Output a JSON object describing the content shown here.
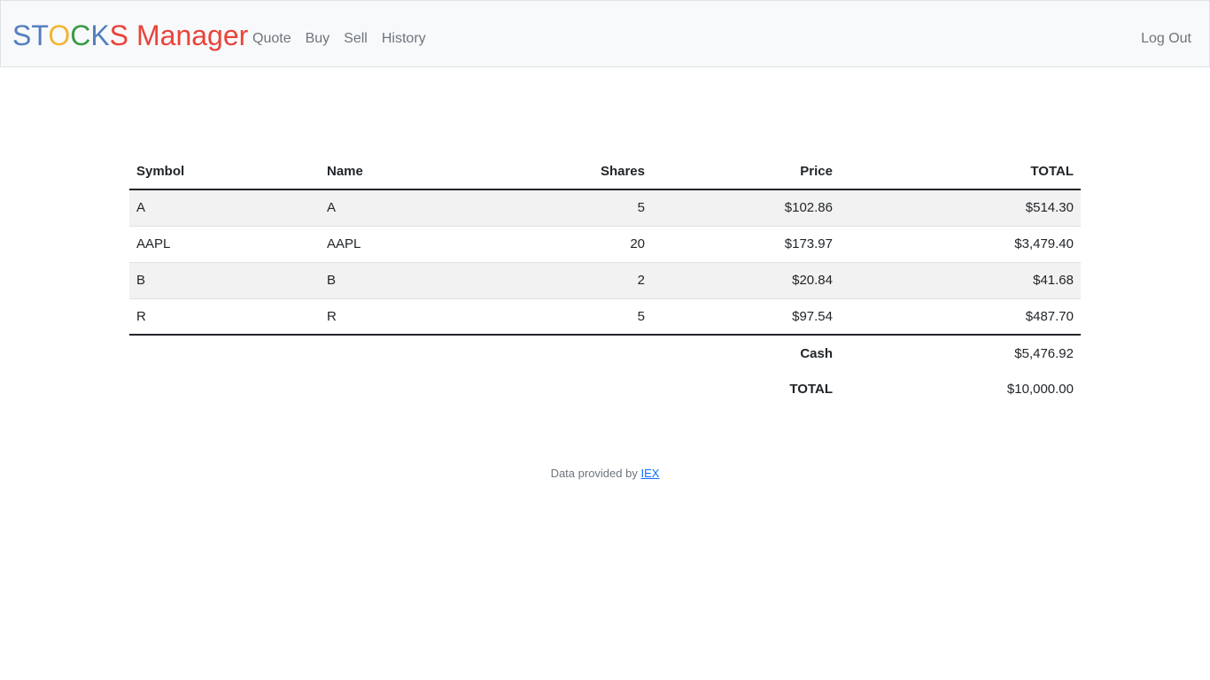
{
  "brand": {
    "letters": [
      {
        "char": "S",
        "color": "#537fbe"
      },
      {
        "char": "T",
        "color": "#537fbe"
      },
      {
        "char": "O",
        "color": "#f5b335"
      },
      {
        "char": "C",
        "color": "#3a9b48"
      },
      {
        "char": "K",
        "color": "#537fbe"
      },
      {
        "char": "S",
        "color": "#ea433b"
      }
    ],
    "word": "Manager",
    "word_color": "#ea433b"
  },
  "nav": {
    "quote": "Quote",
    "buy": "Buy",
    "sell": "Sell",
    "history": "History",
    "logout": "Log Out"
  },
  "table": {
    "headers": {
      "symbol": "Symbol",
      "name": "Name",
      "shares": "Shares",
      "price": "Price",
      "total": "TOTAL"
    },
    "rows": [
      {
        "symbol": "A",
        "name": "A",
        "shares": "5",
        "price": "$102.86",
        "total": "$514.30"
      },
      {
        "symbol": "AAPL",
        "name": "AAPL",
        "shares": "20",
        "price": "$173.97",
        "total": "$3,479.40"
      },
      {
        "symbol": "B",
        "name": "B",
        "shares": "2",
        "price": "$20.84",
        "total": "$41.68"
      },
      {
        "symbol": "R",
        "name": "R",
        "shares": "5",
        "price": "$97.54",
        "total": "$487.70"
      }
    ],
    "footer": {
      "cash_label": "Cash",
      "cash_value": "$5,476.92",
      "total_label": "TOTAL",
      "total_value": "$10,000.00"
    }
  },
  "footer": {
    "text": "Data provided by ",
    "link": "IEX"
  }
}
